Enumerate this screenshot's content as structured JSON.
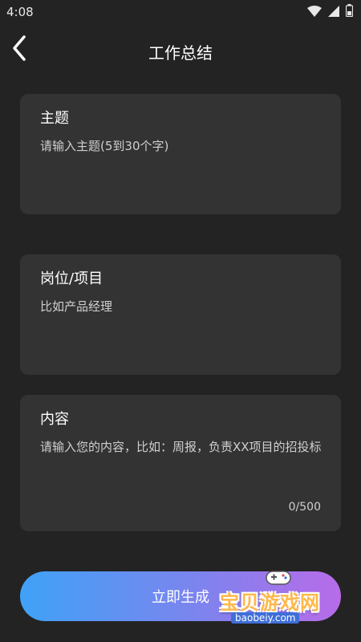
{
  "status_bar": {
    "time": "4:08",
    "icons": [
      "wifi-icon",
      "signal-icon",
      "battery-icon"
    ]
  },
  "header": {
    "title": "工作总结",
    "back_icon": "chevron-left-icon"
  },
  "form": {
    "topic": {
      "label": "主题",
      "placeholder": "请输入主题(5到30个字)"
    },
    "position": {
      "label": "岗位/项目",
      "placeholder": "比如产品经理"
    },
    "content": {
      "label": "内容",
      "placeholder": "请输入您的内容，比如：周报，负责XX项目的招投标",
      "counter": "0/500"
    }
  },
  "actions": {
    "generate_label": "立即生成"
  },
  "watermark": {
    "title": "宝贝游戏网",
    "url": "baobeiy.com",
    "icon": "gamepad-icon"
  },
  "colors": {
    "background": "#232323",
    "card": "#333333",
    "button_gradient_start": "#3fa2f6",
    "button_gradient_end": "#b86be8"
  }
}
